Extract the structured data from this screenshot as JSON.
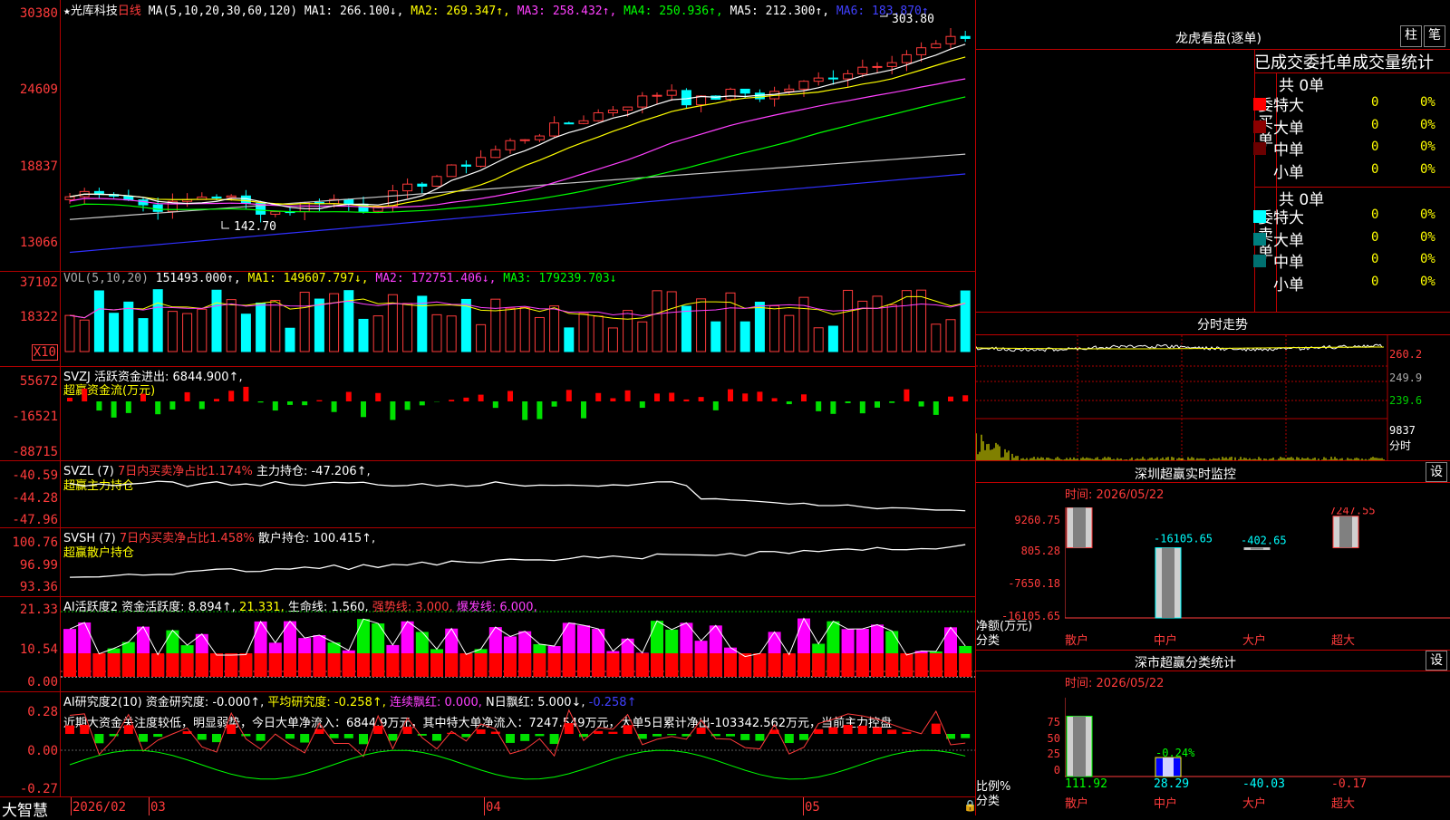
{
  "header": {
    "star": "★",
    "stock_name": "光库科技",
    "period": "日线",
    "ma_label": "MA(5,10,20,30,60,120)",
    "ma_values": [
      "MA1: 266.100↓,",
      "MA2: 269.347↑,",
      "MA3: 258.432↑,",
      "MA4: 250.936↑,",
      "MA5: 212.300↑,",
      "MA6: 183.870↑"
    ],
    "high_mark": "303.80",
    "low_mark": "142.70"
  },
  "price_axis": [
    "30380",
    "24609",
    "18837",
    "13066"
  ],
  "vol_panel": {
    "title": "VOL(5,10,20)",
    "values": [
      "151493.000↑,",
      "MA1: 149607.797↓,",
      "MA2: 172751.406↓,",
      "MA3: 179239.703↓"
    ],
    "axis": [
      "37102",
      "18322"
    ],
    "unit": "X10"
  },
  "svzj_panel": {
    "title": "SVZJ  活跃资金进出: 6844.900↑,",
    "subtitle": "超赢资金流(万元)",
    "axis": [
      "55672",
      "-16521",
      "-88715"
    ]
  },
  "svzl_panel": {
    "title": "SVZL (7)",
    "pct": "7日内买卖净占比1.174%",
    "value": "主力持仓: -47.206↑,",
    "subtitle": "超赢主力持仓",
    "axis": [
      "-40.59",
      "-44.28",
      "-47.96"
    ]
  },
  "svsh_panel": {
    "title": "SVSH (7)",
    "pct": "7日内买卖净占比1.458%",
    "value": "散户持仓: 100.415↑,",
    "subtitle": "超赢散户持仓",
    "axis": [
      "100.76",
      "96.99",
      "93.36"
    ]
  },
  "ai_active": {
    "title": "AI活跃度2",
    "values": [
      "资金活跃度: 8.894↑,",
      "21.331,",
      "生命线: 1.560,",
      "强势线: 3.000,",
      "爆发线: 6.000,"
    ],
    "axis": [
      "21.33",
      "10.54",
      "0.00"
    ]
  },
  "ai_research": {
    "title": "AI研究度2(10)",
    "values": [
      "资金研究度: -0.000↑,",
      "平均研究度: -0.258↑,",
      "连续飘红: 0.000,",
      "N日飘红: 5.000↓,",
      "-0.258↑"
    ],
    "commentary": "近期大资金关注度较低，明显弱势，今日大单净流入：6844.9万元，其中特大单净流入：7247.549万元，大单5日累计净出-103342.562万元，当前主力控盘",
    "axis": [
      "0.28",
      "0.00",
      "-0.27"
    ]
  },
  "footer": {
    "brand": "大智慧",
    "dates": [
      "2026/02",
      "03",
      "04",
      "05"
    ]
  },
  "longhu": {
    "title": "龙虎看盘(逐单)",
    "btn_col": "柱",
    "btn_pen": "笔",
    "header": "已成交委托单成交量统计",
    "buy_side": "委买单",
    "sell_side": "委卖单",
    "buy_total": "共 0单",
    "sell_total": "共 0单",
    "rows": [
      {
        "label": "特大",
        "count": "0",
        "pct": "0%"
      },
      {
        "label": "大单",
        "count": "0",
        "pct": "0%"
      },
      {
        "label": "中单",
        "count": "0",
        "pct": "0%"
      },
      {
        "label": "小单",
        "count": "0",
        "pct": "0%"
      }
    ]
  },
  "fenshi": {
    "title": "分时走势",
    "axis": [
      "260.2",
      "249.9",
      "239.6"
    ],
    "vol_axis": "9837",
    "vol_label": "分时"
  },
  "sz_monitor": {
    "title": "深圳超赢实时监控",
    "btn": "设",
    "time": "时间: 2026/05/22",
    "axis": [
      "9260.75",
      "805.28",
      "-7650.18",
      "-16105.65"
    ],
    "bar_labels": [
      "9260.75",
      "-16105.65",
      "-402.65",
      "7247.55"
    ],
    "y_label": "净额(万元)",
    "x_label": "分类",
    "categories": [
      "散户",
      "中户",
      "大户",
      "超大"
    ]
  },
  "sz_class": {
    "title": "深市超赢分类统计",
    "btn": "设",
    "time": "时间: 2026/05/22",
    "axis": [
      "75",
      "50",
      "25",
      "0"
    ],
    "bar_label": "-0.24%",
    "y_label": "比例%",
    "x_label": "分类",
    "values": [
      "111.92",
      "28.29",
      "-40.03",
      "-0.17"
    ],
    "categories": [
      "散户",
      "中户",
      "大户",
      "超大"
    ]
  },
  "chart_data": [
    {
      "type": "bar",
      "title": "深圳超赢实时监控",
      "ylabel": "净额(万元)",
      "xlabel": "分类",
      "categories": [
        "散户",
        "中户",
        "大户",
        "超大"
      ],
      "values": [
        9260.75,
        -16105.65,
        -402.65,
        7247.55
      ],
      "ylim": [
        -16105.65,
        9260.75
      ]
    },
    {
      "type": "bar",
      "title": "深市超赢分类统计",
      "ylabel": "比例%",
      "xlabel": "分类",
      "categories": [
        "散户",
        "中户",
        "大户",
        "超大"
      ],
      "values": [
        111.92,
        28.29,
        -40.03,
        -0.17
      ]
    }
  ],
  "colors": {
    "up": "#ff3b3b",
    "down": "#00ffff",
    "grid": "#b00000",
    "ma1": "#ffffff",
    "ma2": "#ffff00",
    "ma3": "#ff40ff",
    "ma4": "#00ff00",
    "ma5": "#c8c8c8",
    "ma6": "#3030ff"
  }
}
